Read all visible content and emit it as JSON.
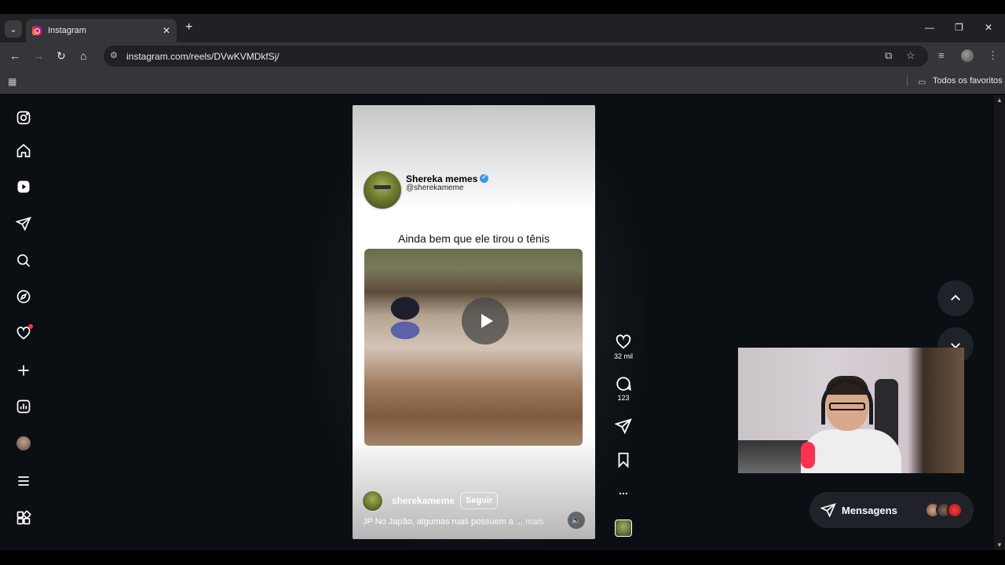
{
  "browser": {
    "tab_title": "Instagram",
    "tab_close": "✕",
    "new_tab": "+",
    "url": "instagram.com/reels/DVwKVMDkfSj/",
    "window_controls": {
      "minimize": "—",
      "maximize": "❐",
      "close": "✕"
    },
    "bookmarks_label": "Todos os favoritos"
  },
  "sidebar": {
    "items": [
      {
        "name": "instagram-logo-icon",
        "label": ""
      },
      {
        "name": "home-icon",
        "label": ""
      },
      {
        "name": "reels-icon",
        "label": ""
      },
      {
        "name": "send-icon",
        "label": ""
      },
      {
        "name": "search-icon",
        "label": ""
      },
      {
        "name": "explore-icon",
        "label": ""
      },
      {
        "name": "notifications-heart-icon",
        "label": ""
      },
      {
        "name": "create-plus-icon",
        "label": ""
      },
      {
        "name": "dashboard-icon",
        "label": ""
      },
      {
        "name": "profile-avatar",
        "label": ""
      },
      {
        "name": "menu-icon",
        "label": ""
      },
      {
        "name": "more-apps-icon",
        "label": ""
      }
    ]
  },
  "reel": {
    "post": {
      "name": "Shereka memes",
      "handle": "@sherekameme",
      "caption": "Ainda bem que ele tirou o tênis"
    },
    "footer": {
      "username": "sherekameme",
      "follow_label": "Seguir",
      "caption": "JP No Japão, algumas ruas possuem a ...",
      "more_label": "mais"
    },
    "actions": {
      "likes": "32 mil",
      "comments": "123",
      "more": "..."
    }
  },
  "messages": {
    "label": "Mensagens"
  },
  "colors": {
    "page_bg": "#0b0f14",
    "accent_verified": "#3897f0",
    "notification": "#ff3040",
    "chrome_dark": "#202124",
    "chrome_mid": "#35363a"
  }
}
